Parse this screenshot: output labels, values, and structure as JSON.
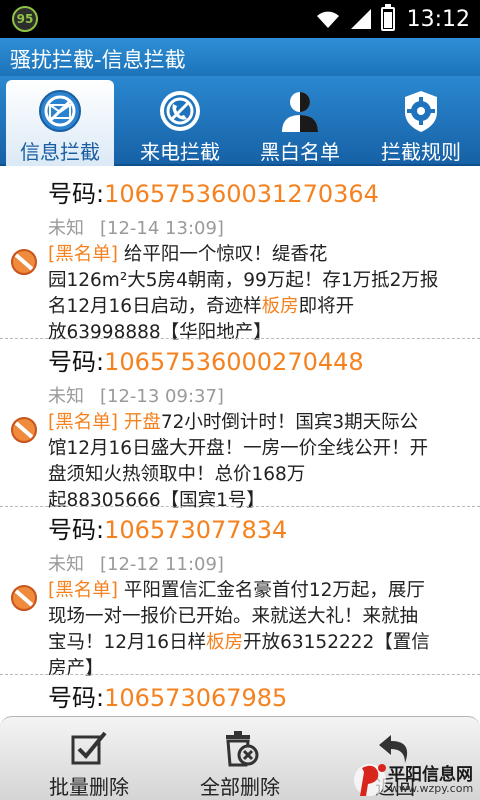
{
  "status_bar": {
    "badge": "95",
    "time": "13:12"
  },
  "title_bar": {
    "title": "骚扰拦截-信息拦截"
  },
  "tabs": [
    {
      "label": "信息拦截",
      "icon": "message-block-icon",
      "active": true
    },
    {
      "label": "来电拦截",
      "icon": "call-block-icon",
      "active": false
    },
    {
      "label": "黑白名单",
      "icon": "contact-list-icon",
      "active": false
    },
    {
      "label": "拦截规则",
      "icon": "settings-gear-icon",
      "active": false
    }
  ],
  "messages": [
    {
      "number_label": "号码:",
      "number": "10657536003127036​4",
      "sender": "未知",
      "time": "[12-14 13:09]",
      "tag": "[黑名单]",
      "lines": [
        [
          {
            "t": "给平阳一个惊叹！缇香花"
          }
        ],
        [
          {
            "t": "园126m²大5房4朝南，99万起！存1万抵2万报"
          }
        ],
        [
          {
            "t": "名12月16日启动，奇迹样"
          },
          {
            "t": "板房",
            "hl": true
          },
          {
            "t": "即将开"
          }
        ],
        [
          {
            "t": "放63998888【华阳地产】"
          }
        ]
      ]
    },
    {
      "number_label": "号码:",
      "number": "10657536000270448",
      "sender": "未知",
      "time": "[12-13 09:37]",
      "tag": "[黑名单]",
      "lines": [
        [
          {
            "t": "开盘",
            "hl": true
          },
          {
            "t": "72小时倒计时！国宾3期天际公"
          }
        ],
        [
          {
            "t": "馆12月16日盛大开盘！一房一价全线公开！开"
          }
        ],
        [
          {
            "t": "盘须知火热领取中！总价168万"
          }
        ],
        [
          {
            "t": "起88305666【国宾1号】"
          }
        ]
      ]
    },
    {
      "number_label": "号码:",
      "number": "106573077834",
      "sender": "未知",
      "time": "[12-12 11:09]",
      "tag": "[黑名单]",
      "lines": [
        [
          {
            "t": "平阳置信汇金名豪首付12万起，展厅"
          }
        ],
        [
          {
            "t": "现场一对一报价已开始。来就送大礼！来就抽"
          }
        ],
        [
          {
            "t": "宝马！12月16日样"
          },
          {
            "t": "板房",
            "hl": true
          },
          {
            "t": "开放63152222【置信"
          }
        ],
        [
          {
            "t": "房产】"
          }
        ]
      ]
    },
    {
      "number_label": "号码:",
      "number": "106573067985"
    }
  ],
  "bottom_bar": {
    "batch_delete": "批量删除",
    "delete_all": "全部删除",
    "back": "返回"
  },
  "watermark": {
    "title": "平阳信息网",
    "url": "www.wzpy.com"
  },
  "colors": {
    "accent_orange": "#f5821f",
    "header_blue": "#1c73b9",
    "tab_active_text": "#1a5ea2"
  }
}
